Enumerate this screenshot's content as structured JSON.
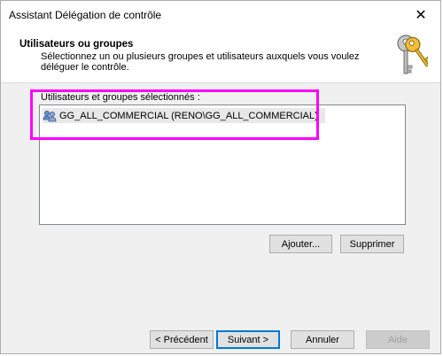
{
  "window": {
    "title": "Assistant Délégation de contrôle",
    "close_glyph": "✕"
  },
  "header": {
    "title": "Utilisateurs ou groupes",
    "description": "Sélectionnez un ou plusieurs groupes et utilisateurs auxquels vous voulez déléguer le contrôle.",
    "icon": "keys-icon"
  },
  "selection": {
    "label": "Utilisateurs et groupes sélectionnés :",
    "items": [
      {
        "icon": "group-icon",
        "text": "GG_ALL_COMMERCIAL (RENO\\GG_ALL_COMMERCIAL)"
      }
    ],
    "highlight_color": "#ff00ff"
  },
  "actions": {
    "add_label": "Ajouter...",
    "remove_label": "Supprimer"
  },
  "footer": {
    "back_label": "< Précédent",
    "next_label": "Suivant >",
    "cancel_label": "Annuler",
    "help_label": "Aide"
  },
  "colors": {
    "accent": "#0078d7",
    "window_bg": "#f0f0f0",
    "panel_bg": "#ffffff"
  }
}
